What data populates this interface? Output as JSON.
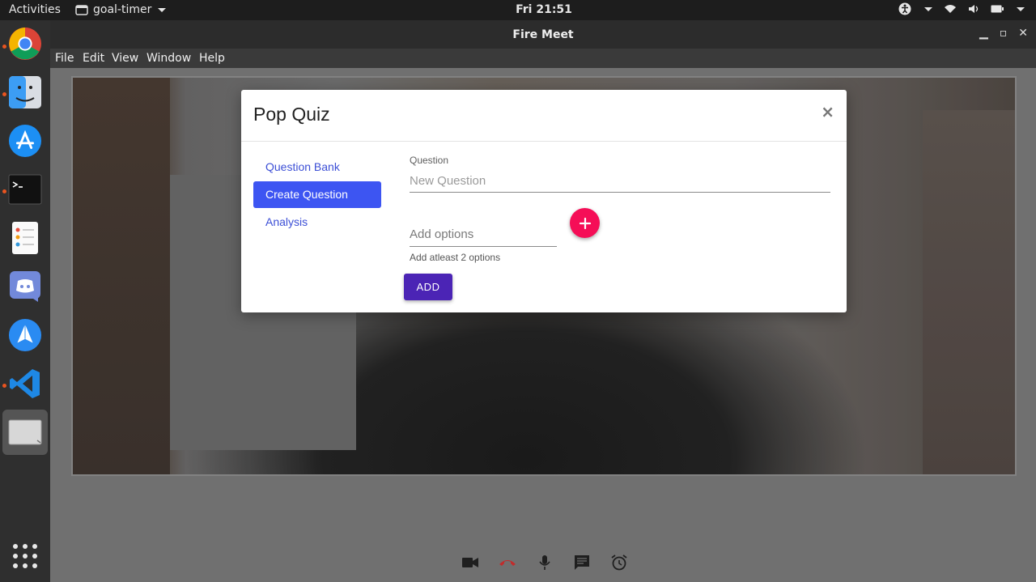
{
  "topbar": {
    "activities": "Activities",
    "app_name": "goal-timer",
    "clock": "Fri 21:51"
  },
  "window": {
    "title": "Fire Meet",
    "menu": [
      "File",
      "Edit",
      "View",
      "Window",
      "Help"
    ]
  },
  "dock": {
    "apps": [
      "chrome-icon",
      "finder-icon",
      "app-store-icon",
      "terminal-icon",
      "reminders-icon",
      "discord-icon",
      "paper-plane-icon",
      "vscode-icon",
      "window-icon"
    ]
  },
  "modal": {
    "title": "Pop Quiz",
    "close": "×",
    "nav": [
      {
        "label": "Question Bank",
        "active": false
      },
      {
        "label": "Create Question",
        "active": true
      },
      {
        "label": "Analysis",
        "active": false
      }
    ],
    "question_label": "Question",
    "question_placeholder": "New Question",
    "options_placeholder": "Add options",
    "options_hint": "Add atleast 2 options",
    "add_button": "ADD",
    "fab_label": "+"
  },
  "colors": {
    "accent": "#3d55f2",
    "fab": "#f50e57",
    "add_button": "#4b24b5",
    "hangup": "#d32f2f"
  },
  "controls": [
    "video-camera-icon",
    "hang-up-icon",
    "microphone-icon",
    "chat-icon",
    "alarm-icon"
  ]
}
